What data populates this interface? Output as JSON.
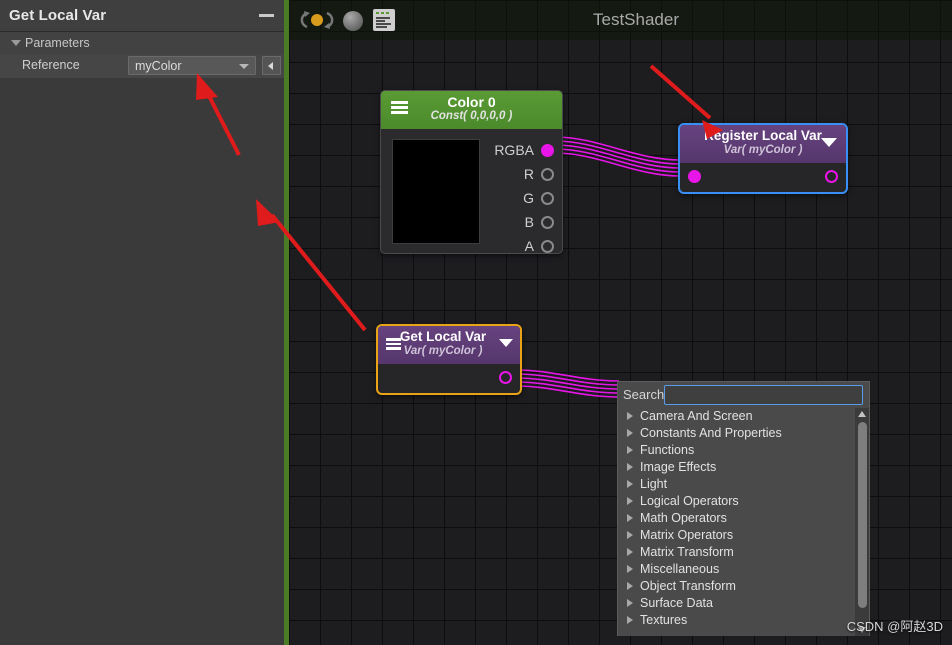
{
  "inspector": {
    "title": "Get Local Var",
    "minimize_icon": "minimize-icon",
    "section_label": "Parameters",
    "section_arrow_icon": "triangle-down-icon",
    "row_label": "Reference",
    "dropdown_value": "myColor",
    "dropdown_caret_icon": "chevron-down-icon",
    "side_button_icon": "triangle-left-icon"
  },
  "graph": {
    "title": "TestShader",
    "toolbar": [
      {
        "name": "refresh-icon",
        "label": "Refresh"
      },
      {
        "name": "sphere-preview-icon",
        "label": "Preview Sphere"
      },
      {
        "name": "code-document-icon",
        "label": "Shader Code"
      }
    ]
  },
  "nodes": {
    "color0": {
      "title": "Color 0",
      "subtitle": "Const( 0,0,0,0 )",
      "menu_icon": "hamburger-icon",
      "swatch_color": "#000000",
      "ports": [
        {
          "label": "RGBA",
          "state": "filled"
        },
        {
          "label": "R",
          "state": "empty"
        },
        {
          "label": "G",
          "state": "empty"
        },
        {
          "label": "B",
          "state": "empty"
        },
        {
          "label": "A",
          "state": "empty"
        }
      ]
    },
    "register_local_var": {
      "title": "Register Local Var",
      "subtitle": "Var( myColor )",
      "caret_icon": "triangle-down-icon",
      "input_port": "filled",
      "output_port": "hollow",
      "selection_color": "#3a8ff5"
    },
    "get_local_var": {
      "title": "Get Local Var",
      "subtitle": "Var( myColor )",
      "menu_icon": "hamburger-icon",
      "caret_icon": "triangle-down-icon",
      "output_port": "hollow",
      "selection_color": "#e8a317"
    }
  },
  "search_panel": {
    "label": "Search",
    "placeholder": "",
    "value": "",
    "items": [
      "Camera And Screen",
      "Constants And Properties",
      "Functions",
      "Image Effects",
      "Light",
      "Logical Operators",
      "Math Operators",
      "Matrix Operators",
      "Matrix Transform",
      "Miscellaneous",
      "Object Transform",
      "Surface Data",
      "Textures"
    ],
    "scroll_up_icon": "triangle-up-icon",
    "scroll_down_icon": "triangle-down-icon"
  },
  "annotations": {
    "arrow_color": "#e01b1b",
    "arrows": [
      {
        "name": "arrow-to-reference-dropdown"
      },
      {
        "name": "arrow-to-get-local-var-node"
      },
      {
        "name": "arrow-to-register-local-var-node"
      }
    ]
  },
  "wire_color": "#e815e8",
  "watermark": "CSDN @阿赵3D"
}
